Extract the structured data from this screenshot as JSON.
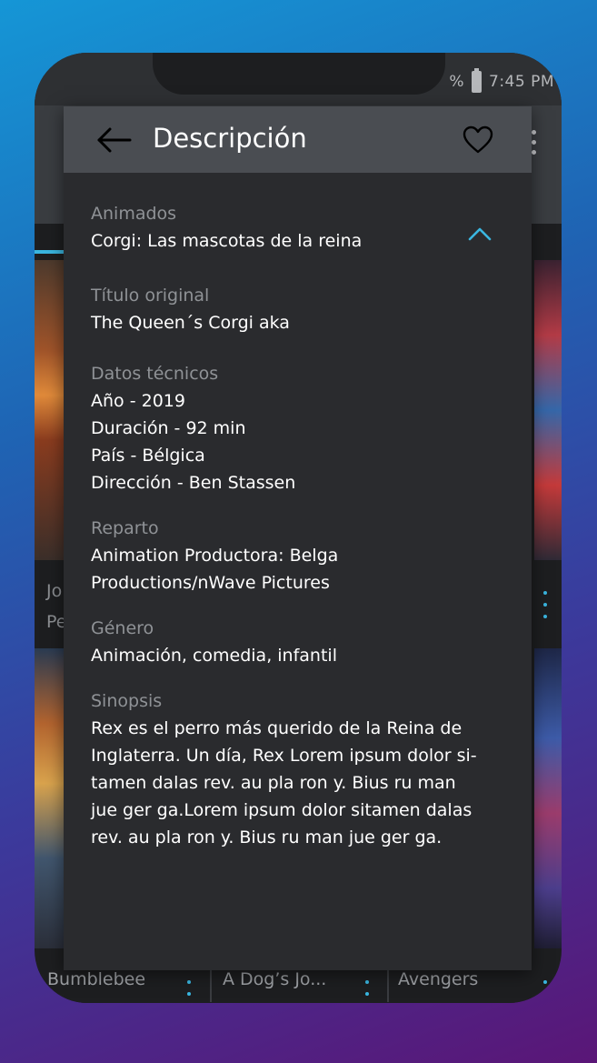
{
  "status_bar": {
    "battery_text": "%",
    "time": "7:45 PM"
  },
  "background": {
    "cards": [
      {
        "title_fragment": "Jo",
        "subtitle_fragment": "Pe"
      }
    ],
    "bottom_titles": [
      "Bumblebee",
      "A Dog’s Jo...",
      "Avengers"
    ]
  },
  "panel": {
    "title": "Descripción",
    "category": {
      "label": "Animados",
      "value": "Corgi: Las mascotas de la reina"
    },
    "original_title": {
      "label": "Título original",
      "value": "The Queen´s Corgi aka"
    },
    "technical": {
      "label": "Datos técnicos",
      "lines": [
        "Año - 2019",
        "Duración - 92 min",
        "País - Bélgica",
        "Dirección - Ben Stassen"
      ]
    },
    "cast": {
      "label": "Reparto",
      "lines": [
        "Animation Productora: Belga",
        "Productions/nWave Pictures"
      ]
    },
    "genre": {
      "label": "Género",
      "value": "Animación, comedia, infantil"
    },
    "synopsis": {
      "label": "Sinopsis",
      "lines": [
        "Rex es el perro más querido de la Reina de",
        "Inglaterra. Un día, Rex Lorem ipsum dolor si-",
        "tamen dalas rev. au pla ron y. Bius ru man",
        "jue ger ga.Lorem ipsum dolor sitamen dalas",
        "rev. au pla ron y. Bius ru man jue ger ga."
      ]
    }
  },
  "colors": {
    "accent": "#3ab6e0",
    "panel_bg": "#2a2b2e",
    "header_bg": "#4a4d52",
    "label_text": "#8f9296"
  },
  "icons": {
    "back": "arrow-left-icon",
    "favorite": "heart-outline-icon",
    "collapse": "chevron-up-icon",
    "menu": "more-vertical-icon",
    "battery": "battery-icon"
  }
}
